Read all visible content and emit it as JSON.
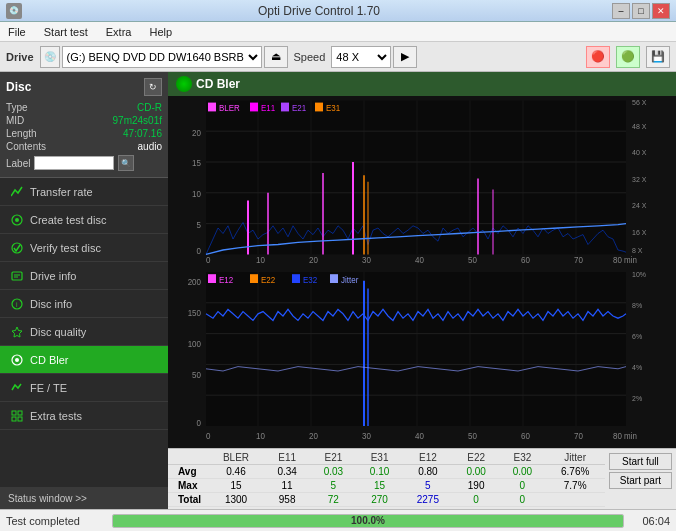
{
  "titlebar": {
    "icon": "disc-icon",
    "title": "Opti Drive Control 1.70",
    "min_btn": "–",
    "max_btn": "□",
    "close_btn": "✕"
  },
  "menubar": {
    "items": [
      {
        "label": "File"
      },
      {
        "label": "Start test"
      },
      {
        "label": "Extra"
      },
      {
        "label": "Help"
      }
    ]
  },
  "drivebar": {
    "drive_label": "Drive",
    "drive_value": "(G:)  BENQ DVD DD DW1640 BSRB",
    "speed_label": "Speed",
    "speed_value": "48 X"
  },
  "disc": {
    "title": "Disc",
    "type_label": "Type",
    "type_value": "CD-R",
    "mid_label": "MID",
    "mid_value": "97m24s01f",
    "length_label": "Length",
    "length_value": "47:07.16",
    "contents_label": "Contents",
    "contents_value": "audio",
    "label_label": "Label",
    "label_value": ""
  },
  "nav": {
    "items": [
      {
        "id": "transfer-rate",
        "label": "Transfer rate",
        "icon": "chart-icon"
      },
      {
        "id": "create-test-disc",
        "label": "Create test disc",
        "icon": "disc-icon"
      },
      {
        "id": "verify-test-disc",
        "label": "Verify test disc",
        "icon": "verify-icon"
      },
      {
        "id": "drive-info",
        "label": "Drive info",
        "icon": "info-icon"
      },
      {
        "id": "disc-info",
        "label": "Disc info",
        "icon": "disc-info-icon"
      },
      {
        "id": "disc-quality",
        "label": "Disc quality",
        "icon": "quality-icon"
      },
      {
        "id": "cd-bler",
        "label": "CD Bler",
        "icon": "bler-icon",
        "active": true
      },
      {
        "id": "fe-te",
        "label": "FE / TE",
        "icon": "fe-icon"
      },
      {
        "id": "extra-tests",
        "label": "Extra tests",
        "icon": "extra-icon"
      }
    ]
  },
  "status_sidebar": "Status window >>",
  "chart": {
    "title": "CD Bler",
    "top_legend": [
      {
        "label": "BLER",
        "color": "#ff00ff"
      },
      {
        "label": "E11",
        "color": "#ff00ff"
      },
      {
        "label": "E21",
        "color": "#aa00ff"
      },
      {
        "label": "E31",
        "color": "#ff6600"
      }
    ],
    "bottom_legend": [
      {
        "label": "E12",
        "color": "#ff00ff"
      },
      {
        "label": "E22",
        "color": "#ff6600"
      },
      {
        "label": "E32",
        "color": "#0066ff"
      },
      {
        "label": "Jitter",
        "color": "#88aaff"
      }
    ],
    "x_labels": [
      "0",
      "10",
      "20",
      "30",
      "40",
      "50",
      "60",
      "70",
      "80 min"
    ],
    "top_y_labels": [
      "20",
      "15",
      "10",
      "5",
      "0"
    ],
    "top_y_right": [
      "56 X",
      "48 X",
      "40 X",
      "32 X",
      "24 X",
      "16 X",
      "8 X"
    ],
    "bottom_y_labels": [
      "200",
      "150",
      "100",
      "50",
      "0"
    ],
    "bottom_y_right": [
      "10%",
      "8%",
      "6%",
      "4%",
      "2%"
    ]
  },
  "stats": {
    "columns": [
      "",
      "BLER",
      "E11",
      "E21",
      "E31",
      "E12",
      "E22",
      "E32",
      "Jitter",
      ""
    ],
    "rows": [
      {
        "label": "Avg",
        "bler": "0.46",
        "e11": "0.34",
        "e21": "0.03",
        "e31": "0.10",
        "e12": "0.80",
        "e22": "0.00",
        "e32": "0.00",
        "jitter": "6.76%"
      },
      {
        "label": "Max",
        "bler": "15",
        "e11": "11",
        "e21": "5",
        "e31": "15",
        "e12": "5",
        "e22": "190",
        "e32": "0",
        "jitter": "7.7%"
      },
      {
        "label": "Total",
        "bler": "1300",
        "e11": "958",
        "e21": "72",
        "e31": "270",
        "e12": "2275",
        "e22": "0",
        "e32": "0",
        "jitter": ""
      }
    ],
    "btn_start_full": "Start full",
    "btn_start_part": "Start part"
  },
  "statusbar": {
    "text": "Test completed",
    "progress": 100,
    "progress_text": "100.0%",
    "time": "06:04"
  },
  "colors": {
    "bler_pink": "#ff44ff",
    "e11_magenta": "#ff00ff",
    "e21_purple": "#aa44ff",
    "e31_orange": "#ee6600",
    "blue_main": "#2244ff",
    "jitter_light": "#8899ff",
    "green_accent": "#22aa22",
    "sidebar_bg": "#2a2a2a"
  }
}
